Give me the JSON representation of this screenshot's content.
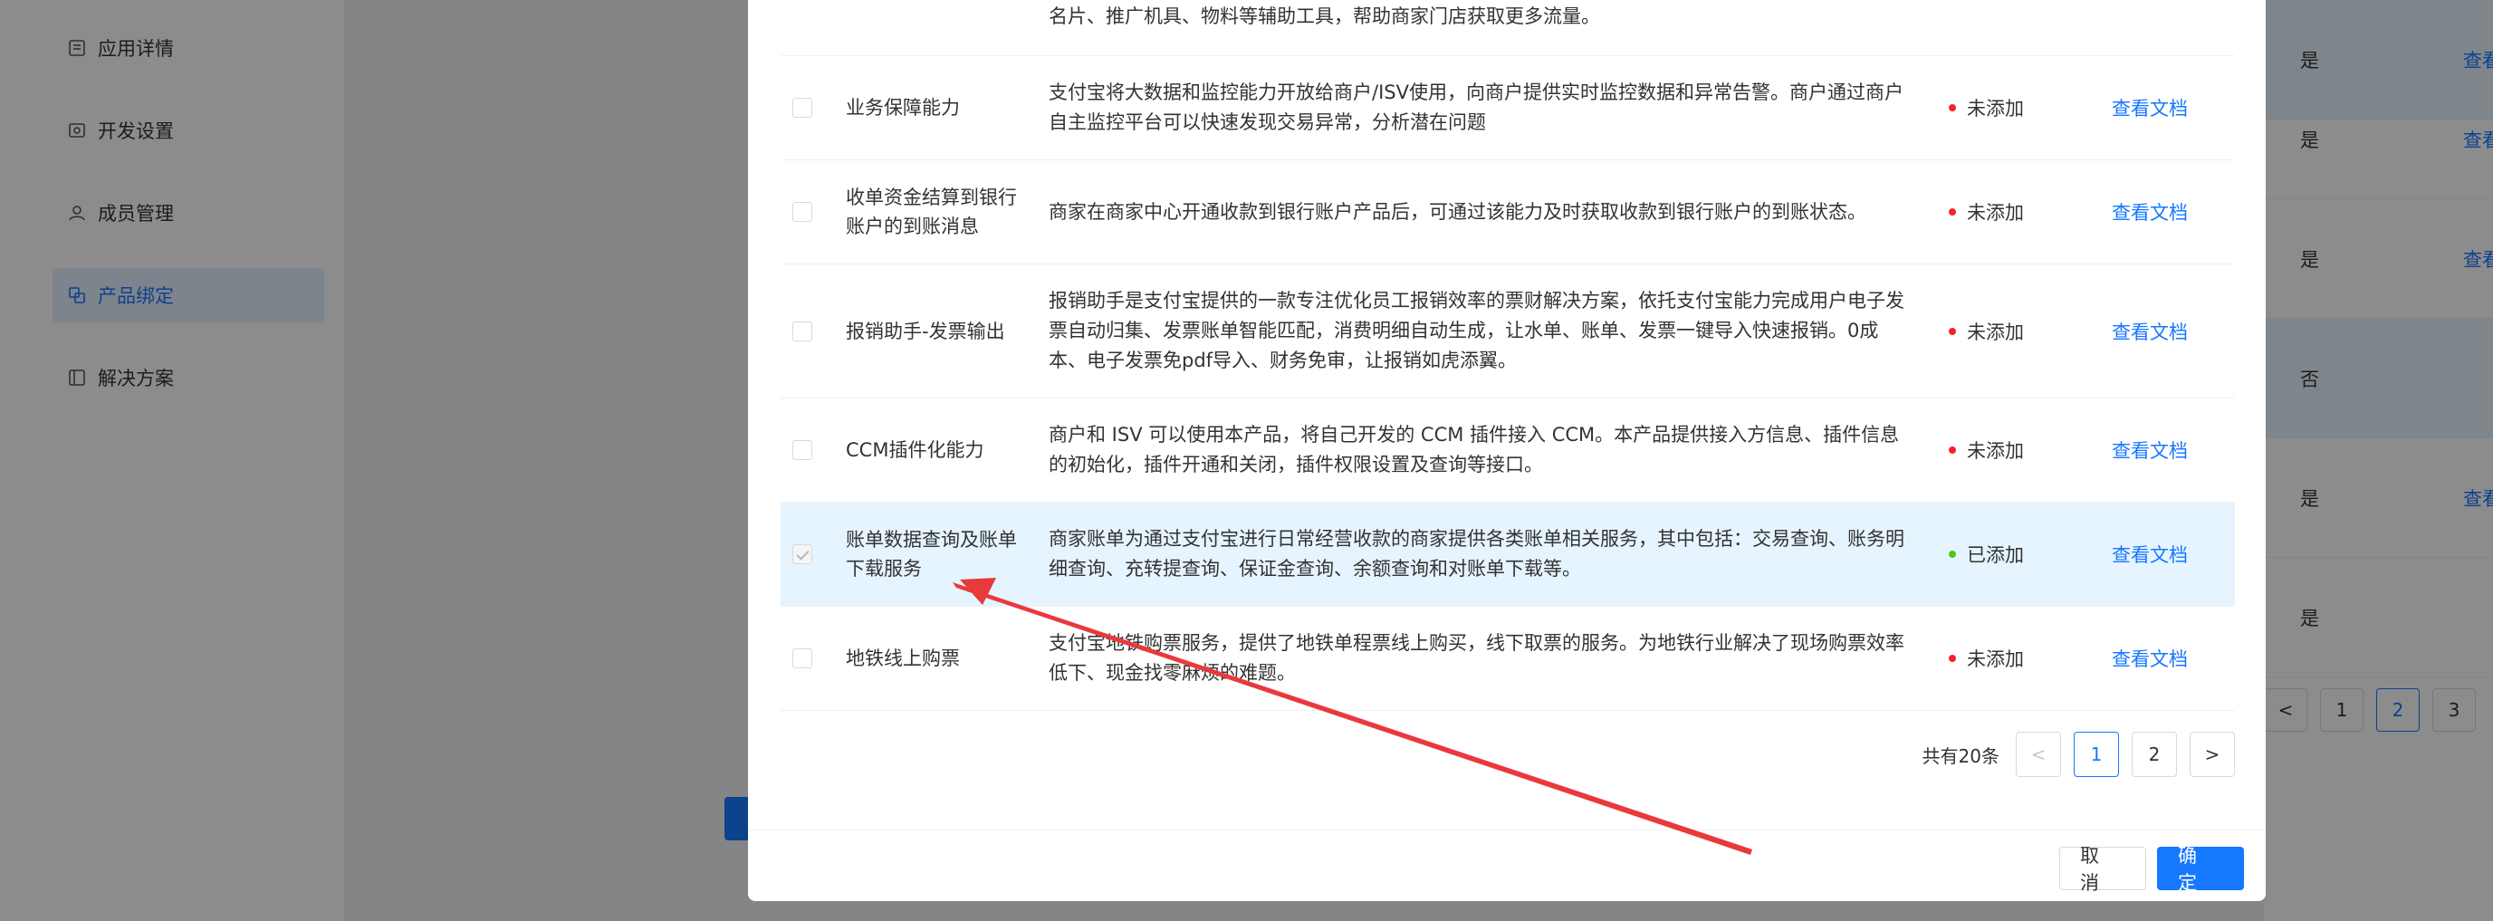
{
  "sidebar": {
    "items": [
      {
        "label": "应用详情",
        "icon": "app-detail-icon"
      },
      {
        "label": "开发设置",
        "icon": "dev-settings-icon"
      },
      {
        "label": "成员管理",
        "icon": "members-icon"
      },
      {
        "label": "产品绑定",
        "icon": "product-bind-icon",
        "active": true
      },
      {
        "label": "解决方案",
        "icon": "solution-icon"
      }
    ]
  },
  "background_table": {
    "rows": [
      {
        "value": "是",
        "link": "查看"
      },
      {
        "value": "是",
        "link": "查看"
      },
      {
        "value": "是",
        "link": "查看"
      },
      {
        "value": "否",
        "link": ""
      },
      {
        "value": "是",
        "link": "查看"
      },
      {
        "value": "是",
        "link": ""
      }
    ],
    "pager": {
      "prev": "<",
      "pages": [
        "1",
        "2",
        "3"
      ],
      "current": "2"
    }
  },
  "modal": {
    "rows": [
      {
        "checked": false,
        "name": "",
        "desc": "名片、推广机具、物料等辅助工具，帮助商家门店获取更多流量。",
        "status": "",
        "link": ""
      },
      {
        "checked": false,
        "name": "业务保障能力",
        "desc": "支付宝将大数据和监控能力开放给商户/ISV使用，向商户提供实时监控数据和异常告警。商户通过商户自主监控平台可以快速发现交易异常，分析潜在问题",
        "status": "未添加",
        "link": "查看文档"
      },
      {
        "checked": false,
        "name": "收单资金结算到银行账户的到账消息",
        "desc": "商家在商家中心开通收款到银行账户产品后，可通过该能力及时获取收款到银行账户的到账状态。",
        "status": "未添加",
        "link": "查看文档"
      },
      {
        "checked": false,
        "name": "报销助手-发票输出",
        "desc": "报销助手是支付宝提供的一款专注优化员工报销效率的票财解决方案，依托支付宝能力完成用户电子发票自动归集、发票账单智能匹配，消费明细自动生成，让水单、账单、发票一键导入快速报销。0成本、电子发票免pdf导入、财务免审，让报销如虎添翼。",
        "status": "未添加",
        "link": "查看文档"
      },
      {
        "checked": false,
        "name": "CCM插件化能力",
        "desc": "商户和 ISV 可以使用本产品，将自己开发的 CCM 插件接入 CCM。本产品提供接入方信息、插件信息的初始化，插件开通和关闭，插件权限设置及查询等接口。",
        "status": "未添加",
        "link": "查看文档"
      },
      {
        "checked": true,
        "name": "账单数据查询及账单下载服务",
        "desc": "商家账单为通过支付宝进行日常经营收款的商家提供各类账单相关服务，其中包括：交易查询、账务明细查询、充转提查询、保证金查询、余额查询和对账单下载等。",
        "status": "已添加",
        "link": "查看文档"
      },
      {
        "checked": false,
        "name": "地铁线上购票",
        "desc": "支付宝地铁购票服务，提供了地铁单程票线上购买，线下取票的服务。为地铁行业解决了现场购票效率低下、现金找零麻烦的难题。",
        "status": "未添加",
        "link": "查看文档"
      }
    ],
    "pager": {
      "total": "共有20条",
      "prev": "<",
      "pages": [
        "1",
        "2"
      ],
      "current": "1",
      "next": ">"
    },
    "footer": {
      "cancel": "取 消",
      "ok": "确 定"
    }
  },
  "colors": {
    "primary": "#1677ff",
    "not_added": "#f5222d",
    "added": "#52c41a",
    "arrow": "#e8393c"
  }
}
